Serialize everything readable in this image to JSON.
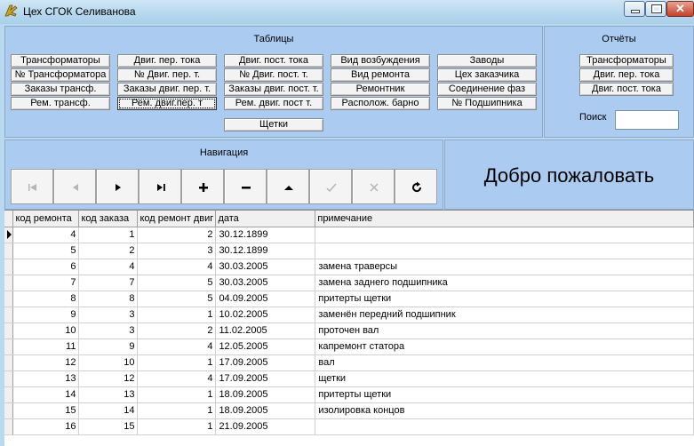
{
  "window": {
    "title": "Цех СГОК Селиванова"
  },
  "tables_panel": {
    "title": "Таблицы",
    "buttons": [
      "Трансформаторы",
      "№ Трансформатора",
      "Заказы трансф.",
      "Рем. трансф.",
      "Двиг. пер. тока",
      "№ Двиг. пер. т.",
      "Заказы двиг. пер. т.",
      "Рем. двиг.пер. т",
      "Двиг. пост. тока",
      "№ Двиг. пост. т.",
      "Заказы двиг. пост. т.",
      "Рем. двиг. пост т.",
      "Вид возбуждения",
      "Вид ремонта",
      "Ремонтник",
      "Располож. барно",
      "Заводы",
      "Цех заказчика",
      "Соединение фаз",
      "№ Подшипника",
      "Щетки"
    ]
  },
  "reports_panel": {
    "title": "Отчёты",
    "buttons": [
      "Трансформаторы",
      "Двиг. пер. тока",
      "Двиг. пост. тока"
    ],
    "search_label": "Поиск",
    "search_value": ""
  },
  "navigation": {
    "title": "Навигация",
    "buttons": [
      {
        "icon": "first-record-icon",
        "enabled": false
      },
      {
        "icon": "prior-record-icon",
        "enabled": false
      },
      {
        "icon": "next-record-icon",
        "enabled": true
      },
      {
        "icon": "last-record-icon",
        "enabled": true
      },
      {
        "icon": "insert-record-icon",
        "enabled": true
      },
      {
        "icon": "delete-record-icon",
        "enabled": true
      },
      {
        "icon": "edit-record-icon",
        "enabled": true
      },
      {
        "icon": "post-record-icon",
        "enabled": false
      },
      {
        "icon": "cancel-edit-icon",
        "enabled": false
      },
      {
        "icon": "refresh-icon",
        "enabled": true
      }
    ]
  },
  "welcome": {
    "text": "Добро пожаловать"
  },
  "grid": {
    "columns": [
      "код ремонта",
      "код заказа",
      "код ремонт двиг",
      "дата",
      "примечание"
    ],
    "rows": [
      [
        "4",
        "1",
        "2",
        "30.12.1899",
        ""
      ],
      [
        "5",
        "2",
        "3",
        "30.12.1899",
        ""
      ],
      [
        "6",
        "4",
        "4",
        "30.03.2005",
        "замена траверсы"
      ],
      [
        "7",
        "7",
        "5",
        "30.03.2005",
        "замена заднего подшипника"
      ],
      [
        "8",
        "8",
        "5",
        "04.09.2005",
        "притерты щетки"
      ],
      [
        "9",
        "3",
        "1",
        "10.02.2005",
        "заменён передний подшипник"
      ],
      [
        "10",
        "3",
        "2",
        "11.02.2005",
        "проточен вал"
      ],
      [
        "11",
        "9",
        "4",
        "12.05.2005",
        "капремонт статора"
      ],
      [
        "12",
        "10",
        "1",
        "17.09.2005",
        "вал"
      ],
      [
        "13",
        "12",
        "4",
        "17.09.2005",
        "щетки"
      ],
      [
        "14",
        "13",
        "1",
        "18.09.2005",
        "притерты щетки"
      ],
      [
        "15",
        "14",
        "1",
        "18.09.2005",
        "изолировка концов"
      ],
      [
        "16",
        "15",
        "1",
        "21.09.2005",
        ""
      ]
    ]
  },
  "colors": {
    "frame": "#b9d9ef",
    "panel": "#abcbf0"
  }
}
